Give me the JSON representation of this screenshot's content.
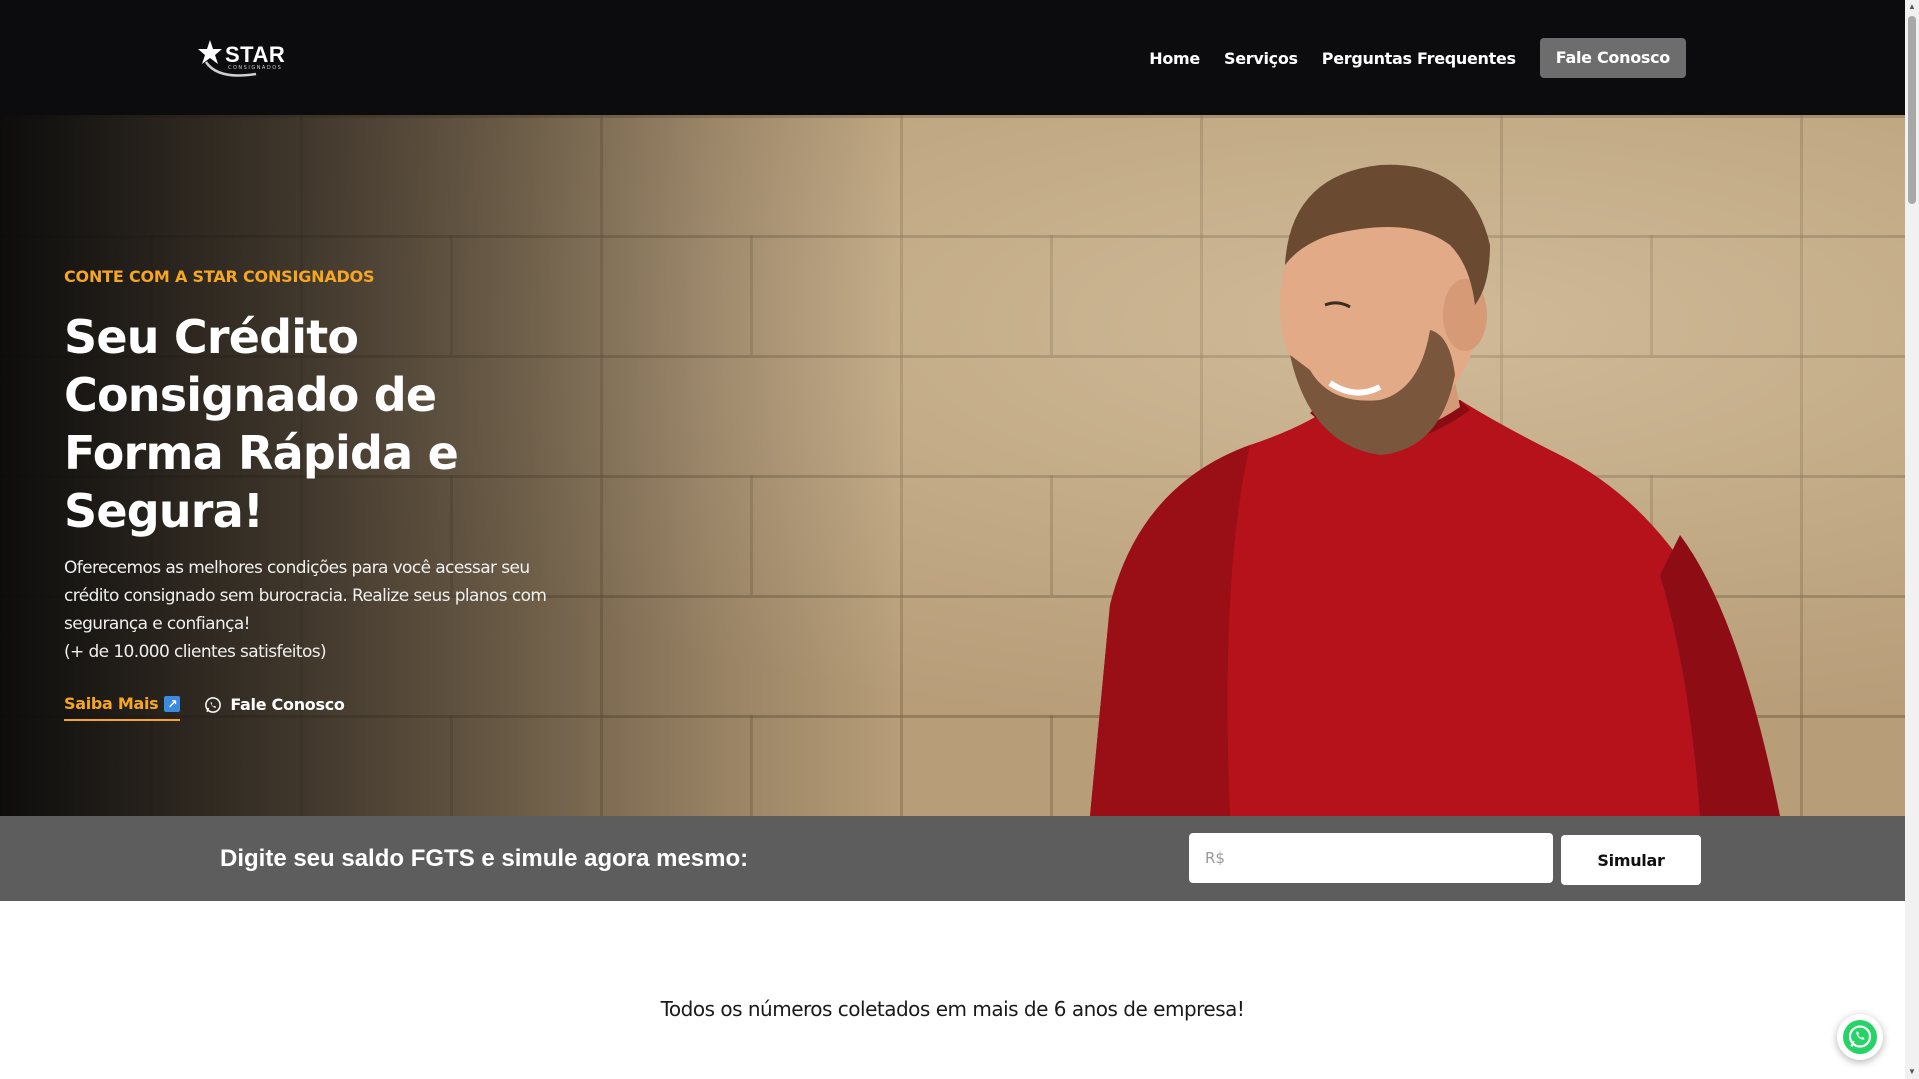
{
  "header": {
    "logo_text": "STAR",
    "logo_subtext": "CONSIGNADOS",
    "nav": [
      {
        "label": "Home"
      },
      {
        "label": "Serviços"
      },
      {
        "label": "Perguntas Frequentes"
      }
    ],
    "cta_label": "Fale Conosco"
  },
  "hero": {
    "eyebrow": "CONTE COM A STAR CONSIGNADOS",
    "title": "Seu Crédito Consignado de Forma Rápida e Segura!",
    "description": "Oferecemos as melhores condições para você acessar seu crédito consignado sem burocracia. Realize seus planos com segurança e confiança!",
    "clients_note": "(+ de 10.000 clientes satisfeitos)",
    "saiba_mais_label": "Saiba Mais",
    "fale_conosco_label": "Fale Conosco"
  },
  "simulator": {
    "label": "Digite seu saldo FGTS e simule agora mesmo:",
    "input_placeholder": "R$",
    "input_value": "",
    "button_label": "Simular"
  },
  "stats": {
    "caption": "Todos os números coletados em mais de 6 anos de empresa!"
  },
  "colors": {
    "accent": "#f5a623",
    "header_bg": "#0c0b0d",
    "bar_bg": "#5d5d5d",
    "cta_bg": "#6d6d6d",
    "whatsapp": "#25d366"
  },
  "icons": {
    "logo": "star-icon",
    "saiba_mais": "external-link-icon",
    "fale_conosco": "whatsapp-icon",
    "floating": "whatsapp-icon"
  }
}
